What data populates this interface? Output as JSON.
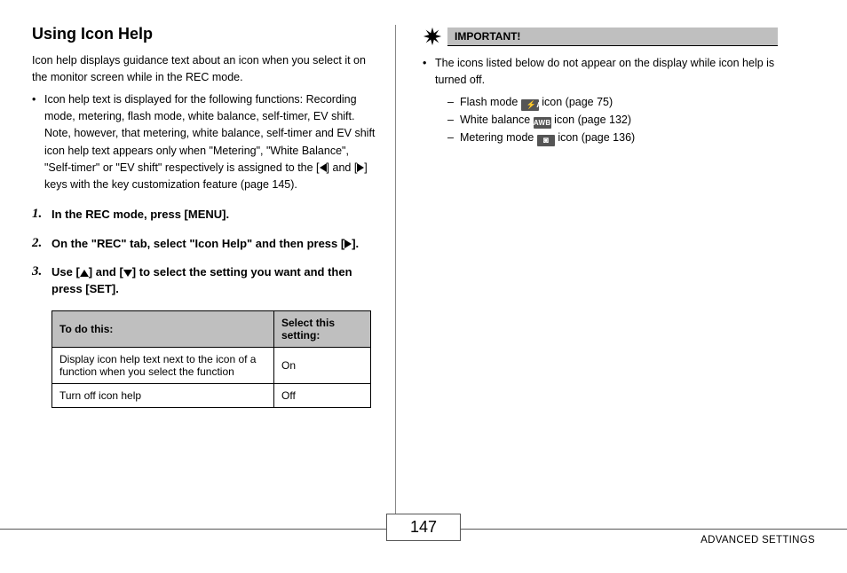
{
  "heading": "Using Icon Help",
  "intro": "Icon help displays guidance text about an icon when you select it on the monitor screen while in the REC mode.",
  "bullet1": "Icon help text is displayed for the following functions: Recording mode, metering, flash mode, white balance, self-timer, EV shift. Note, however, that metering, white balance, self-timer and EV shift icon help text appears only when \"Metering\", \"White Balance\", \"Self-timer\" or \"EV shift\" respectively is assigned to the [",
  "bullet1b": "] and [",
  "bullet1c": "] keys with the key customization feature (page 145).",
  "steps": {
    "s1n": "1.",
    "s1": "In the REC mode, press [MENU].",
    "s2n": "2.",
    "s2a": "On the \"REC\" tab, select \"Icon Help\" and then press [",
    "s2b": "].",
    "s3n": "3.",
    "s3a": "Use [",
    "s3b": "] and [",
    "s3c": "] to select the setting you want and then press [SET]."
  },
  "table": {
    "h1": "To do this:",
    "h2": "Select this setting:",
    "r1c1": "Display icon help text next to the icon of a function when you select the function",
    "r1c2": "On",
    "r2c1": "Turn off icon help",
    "r2c2": "Off"
  },
  "important": {
    "label": "IMPORTANT!",
    "lead": "The icons listed below do not appear on the display while icon help is turned off.",
    "i1a": "Flash mode ",
    "i1_icon": "A",
    "i1b": " icon (page 75)",
    "i2a": "White balance ",
    "i2_icon": "AWB",
    "i2b": " icon (page 132)",
    "i3a": "Metering mode ",
    "i3_icon": "◙",
    "i3b": " icon (page 136)"
  },
  "footer": {
    "page": "147",
    "section": "ADVANCED SETTINGS"
  }
}
